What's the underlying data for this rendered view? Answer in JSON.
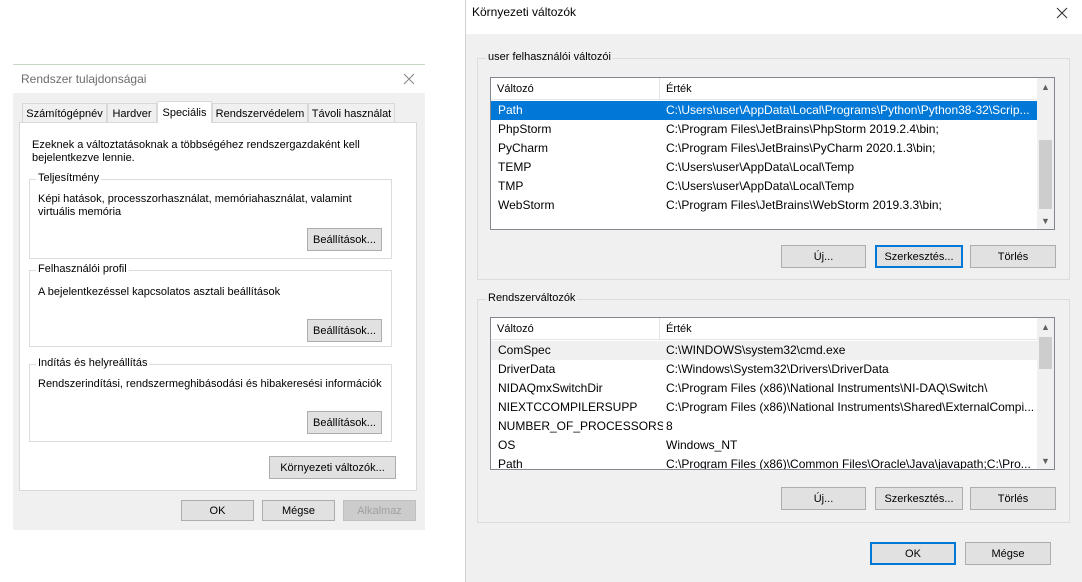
{
  "system_properties": {
    "title": "Rendszer tulajdonságai",
    "tabs": [
      "Számítógépnév",
      "Hardver",
      "Speciális",
      "Rendszervédelem",
      "Távoli használat"
    ],
    "active_tab": "Speciális",
    "admin_notice": "Ezeknek a változtatásoknak a többségéhez rendszergazdaként kell bejelentkezve lennie.",
    "groups": {
      "performance": {
        "title": "Teljesítmény",
        "description": "Képi hatások, processzorhasználat, memóriahasználat, valamint virtuális memória",
        "button": "Beállítások..."
      },
      "user_profile": {
        "title": "Felhasználói profil",
        "description": "A bejelentkezéssel kapcsolatos asztali beállítások",
        "button": "Beállítások..."
      },
      "startup_recovery": {
        "title": "Indítás és helyreállítás",
        "description": "Rendszerindítási, rendszermeghibásodási és hibakeresési információk",
        "button": "Beállítások..."
      }
    },
    "env_button": "Környezeti változók...",
    "ok": "OK",
    "cancel": "Mégse",
    "apply": "Alkalmaz"
  },
  "env_vars": {
    "title": "Környezeti változók",
    "user_group_title": "user felhasználói változói",
    "system_group_title": "Rendszerváltozók",
    "col_variable": "Változó",
    "col_value": "Érték",
    "user_vars": [
      {
        "name": "Path",
        "value": "C:\\Users\\user\\AppData\\Local\\Programs\\Python\\Python38-32\\Scrip...",
        "selected": true
      },
      {
        "name": "PhpStorm",
        "value": "C:\\Program Files\\JetBrains\\PhpStorm 2019.2.4\\bin;"
      },
      {
        "name": "PyCharm",
        "value": "C:\\Program Files\\JetBrains\\PyCharm 2020.1.3\\bin;"
      },
      {
        "name": "TEMP",
        "value": "C:\\Users\\user\\AppData\\Local\\Temp"
      },
      {
        "name": "TMP",
        "value": "C:\\Users\\user\\AppData\\Local\\Temp"
      },
      {
        "name": "WebStorm",
        "value": "C:\\Program Files\\JetBrains\\WebStorm 2019.3.3\\bin;"
      }
    ],
    "system_vars": [
      {
        "name": "ComSpec",
        "value": "C:\\WINDOWS\\system32\\cmd.exe",
        "hot": true
      },
      {
        "name": "DriverData",
        "value": "C:\\Windows\\System32\\Drivers\\DriverData"
      },
      {
        "name": "NIDAQmxSwitchDir",
        "value": "C:\\Program Files (x86)\\National Instruments\\NI-DAQ\\Switch\\"
      },
      {
        "name": "NIEXTCCOMPILERSUPP",
        "value": "C:\\Program Files (x86)\\National Instruments\\Shared\\ExternalCompi..."
      },
      {
        "name": "NUMBER_OF_PROCESSORS",
        "value": "8"
      },
      {
        "name": "OS",
        "value": "Windows_NT"
      },
      {
        "name": "Path",
        "value": "C:\\Program Files (x86)\\Common Files\\Oracle\\Java\\javapath;C:\\Pro..."
      }
    ],
    "new_button": "Új...",
    "edit_button": "Szerkesztés...",
    "delete_button": "Törlés",
    "ok": "OK",
    "cancel": "Mégse"
  }
}
